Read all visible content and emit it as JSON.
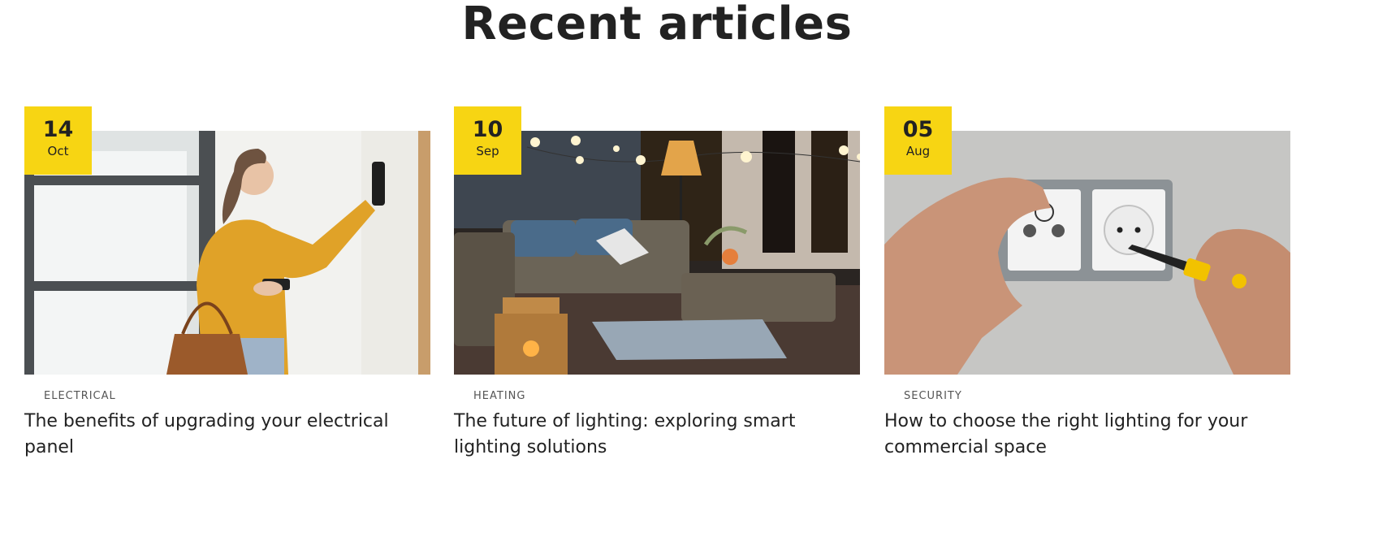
{
  "section": {
    "title": "Recent articles"
  },
  "articles": [
    {
      "day": "14",
      "month": "Oct",
      "category": "ELECTRICAL",
      "title": "The benefits of upgrading your electrical panel",
      "image": "woman-using-smart-thermostat"
    },
    {
      "day": "10",
      "month": "Sep",
      "category": "HEATING",
      "title": "The future of lighting: exploring smart lighting solutions",
      "image": "patio-with-string-lights"
    },
    {
      "day": "05",
      "month": "Aug",
      "category": "SECURITY",
      "title": "How to choose the right lighting for your commercial space",
      "image": "hands-installing-wall-socket"
    }
  ],
  "colors": {
    "accent": "#f7d513",
    "text": "#222222",
    "category": "#555555"
  }
}
